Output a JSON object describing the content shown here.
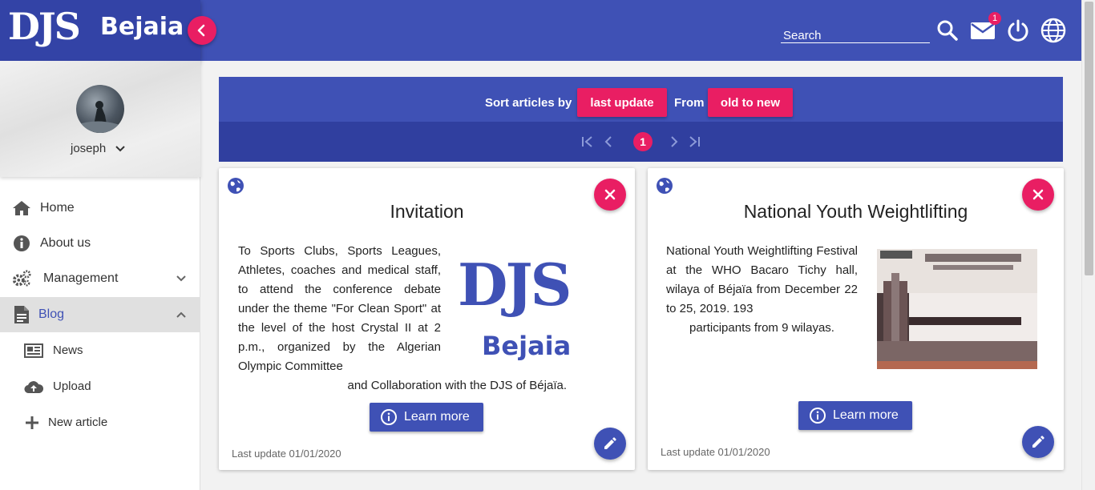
{
  "brand": {
    "logo_text": "DJS",
    "name": "Bejaia",
    "colors": {
      "primary": "#3f51b5",
      "primary_dark": "#303f9f",
      "accent": "#e91e63"
    }
  },
  "topbar": {
    "search_label": "Search",
    "mail_badge": "1",
    "icons": [
      "search-icon",
      "mail-icon",
      "power-icon",
      "globe-icon"
    ]
  },
  "sidebar": {
    "user": {
      "name": "joseph"
    },
    "items": [
      {
        "label": "Home",
        "icon": "home-icon"
      },
      {
        "label": "About us",
        "icon": "info-icon"
      },
      {
        "label": "Management",
        "icon": "gears-icon"
      },
      {
        "label": "Blog",
        "icon": "document-icon"
      }
    ],
    "blog_sub": [
      {
        "label": "News",
        "icon": "newspaper-icon"
      },
      {
        "label": "Upload",
        "icon": "cloud-upload-icon"
      },
      {
        "label": "New article",
        "icon": "plus-icon"
      }
    ]
  },
  "sort": {
    "label": "Sort articles by",
    "field_value": "last update",
    "from_label": "From",
    "order_value": "old to new"
  },
  "pagination": {
    "current": "1"
  },
  "articles": [
    {
      "title": "Invitation",
      "body": "To Sports Clubs, Sports Leagues, Athletes, coaches and medical staff, to attend the conference debate under the theme \"For Clean Sport\" at the level of the host Crystal II at 2 p.m., organized by the Algerian Olympic Committee",
      "body_tail": "and Collaboration with the DJS of Béjaïa.",
      "image_logo_text": "DJS",
      "image_logo_name": "Bejaia",
      "button": "Learn more",
      "date": "Last update 01/01/2020"
    },
    {
      "title": "National Youth Weightlifting",
      "body": "National Youth Weightlifting Festival at the WHO Bacaro Tichy hall, wilaya of Béjaïa from December 22 to 25, 2019. 193",
      "body_tail": "participants from 9 wilayas.",
      "button": "Learn more",
      "date": "Last update 01/01/2020"
    }
  ]
}
